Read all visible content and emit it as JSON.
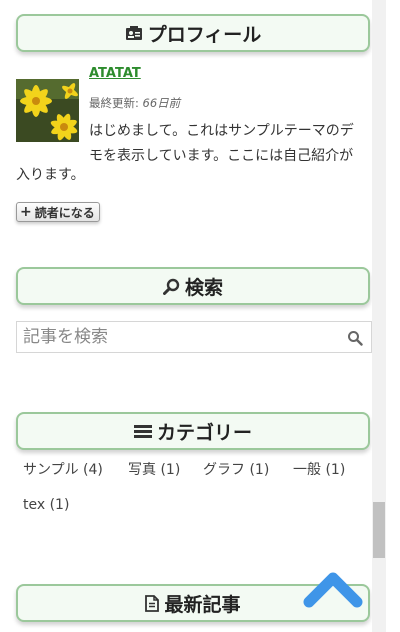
{
  "profile": {
    "heading": "プロフィール",
    "blog_name": "ATATAT",
    "updated_label": "最終更新: ",
    "updated_value": "66日前",
    "bio_line1": "はじめまして。これはサンプルテーマのデ",
    "bio_line2": "モを表示しています。ここには自己紹介が",
    "bio_line3": "入ります。",
    "reader_button": "読者になる"
  },
  "search": {
    "heading": "検索",
    "placeholder": "記事を検索"
  },
  "categories": {
    "heading": "カテゴリー",
    "items": [
      {
        "label": "サンプル (4)"
      },
      {
        "label": "写真 (1)"
      },
      {
        "label": "グラフ (1)"
      },
      {
        "label": "一般 (1)"
      },
      {
        "label": "tex (1)"
      }
    ]
  },
  "recent": {
    "heading": "最新記事"
  },
  "colors": {
    "accent": "#2d8c2d",
    "heading_border": "#9bc89b",
    "heading_bg": "#f3faf3",
    "scroll_top": "#3f95e8"
  },
  "icons": {
    "profile": "id-card-icon",
    "search": "magnifier-icon",
    "category": "list-icon",
    "recent": "document-icon",
    "scroll_top": "chevron-up-icon"
  }
}
